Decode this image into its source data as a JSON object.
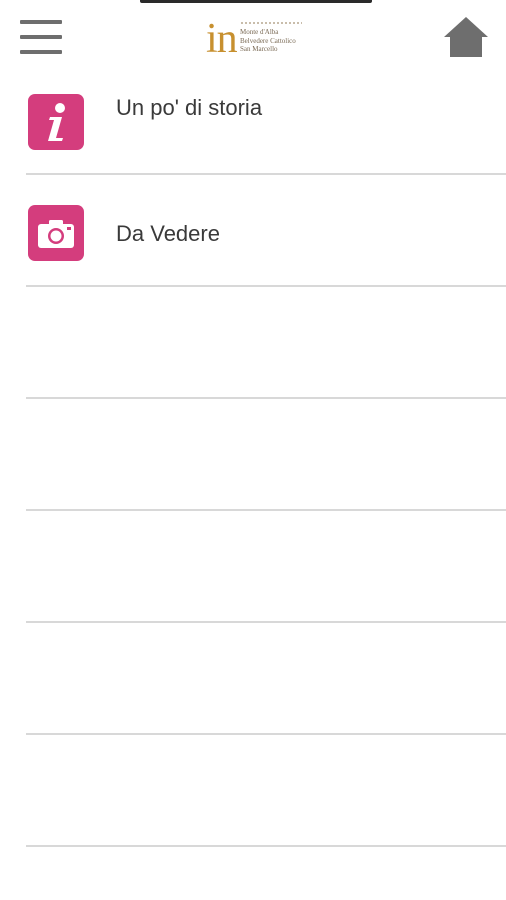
{
  "header": {
    "menu_icon": "hamburger-menu-icon",
    "logo": {
      "mark": "in",
      "lines": [
        "Monte d'Alba",
        "Belvedere Cattolico",
        "San Marcello"
      ]
    },
    "home_icon": "home-icon"
  },
  "menu": {
    "items": [
      {
        "label": "Un po' di storia",
        "icon": "info-icon",
        "icon_color": "#d43d7d"
      },
      {
        "label": "Da Vedere",
        "icon": "camera-icon",
        "icon_color": "#d43d7d"
      }
    ]
  },
  "colors": {
    "accent": "#d43d7d",
    "logo_gold": "#c7902f",
    "divider": "#d8d8d8",
    "text": "#3a3a3a",
    "icon_gray": "#6e6e6e"
  }
}
